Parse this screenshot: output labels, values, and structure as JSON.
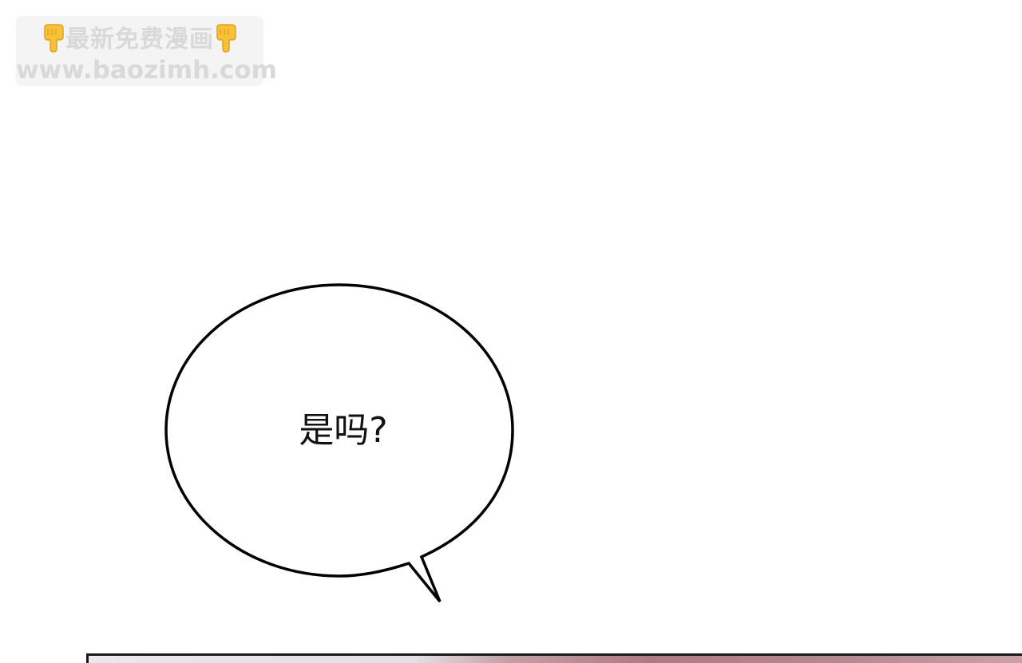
{
  "watermark": {
    "line1": "最新免费漫画",
    "line2": "www.baozimh.com",
    "hand_icon": "pointing-down-hand-icon",
    "color": "#d9d9d9"
  },
  "speech_bubble": {
    "text": "是吗?",
    "outline_color": "#000000",
    "fill_color": "#ffffff"
  },
  "next_panel": {
    "border_color": "#1a1a1a"
  }
}
